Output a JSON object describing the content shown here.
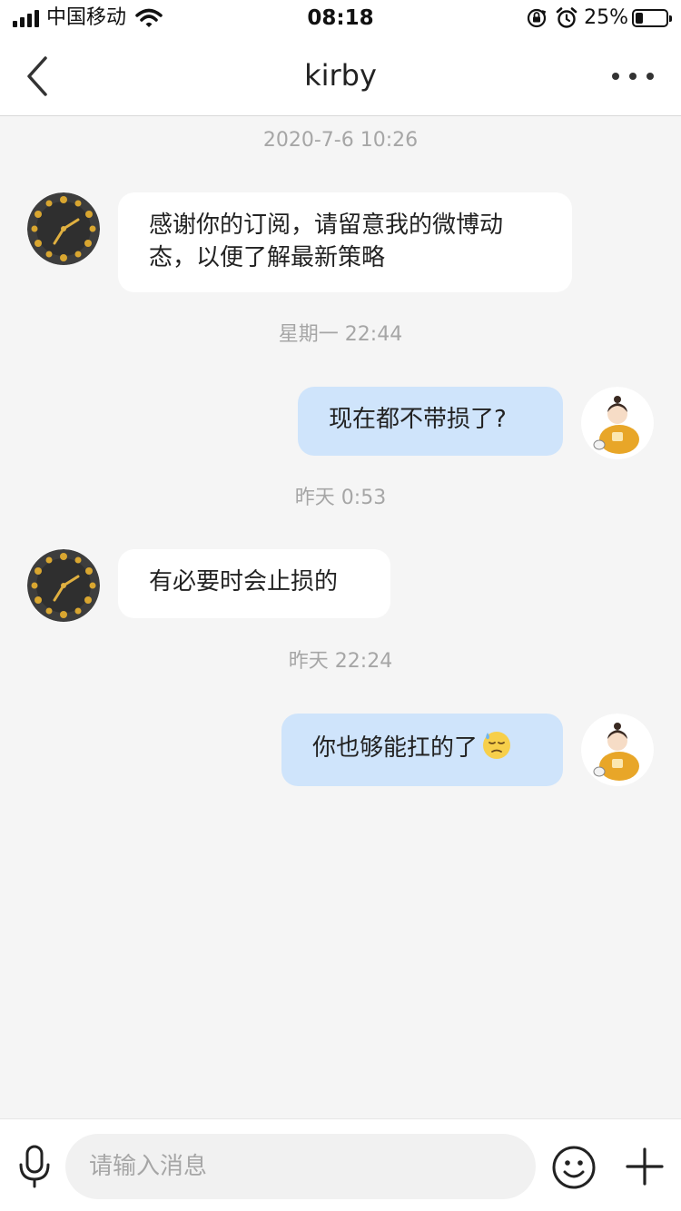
{
  "status_bar": {
    "carrier": "中国移动",
    "time": "08:18",
    "battery_percent": "25%",
    "battery_level": 0.25,
    "icons": [
      "signal-icon",
      "wifi-icon",
      "orientation-lock-icon",
      "alarm-icon",
      "battery-icon"
    ]
  },
  "nav": {
    "title": "kirby",
    "icons": [
      "back-chevron-icon",
      "more-dots-icon"
    ]
  },
  "messages": [
    {
      "timestamp": "2020-7-6 10:26",
      "direction": "incoming",
      "text": "感谢你的订阅，请留意我的微博动态，以便了解最新策略"
    },
    {
      "timestamp": "星期一 22:44",
      "direction": "outgoing",
      "text": "现在都不带损了?"
    },
    {
      "timestamp": "昨天 0:53",
      "direction": "incoming",
      "text": "有必要时会止损的"
    },
    {
      "timestamp": "昨天 22:24",
      "direction": "outgoing",
      "text": "你也够能扛的了",
      "emoji": "sweat-emoji-icon"
    }
  ],
  "input": {
    "placeholder": "请输入消息",
    "value": "",
    "icons": [
      "microphone-icon",
      "smiley-icon",
      "plus-icon"
    ]
  },
  "colors": {
    "background": "#f5f5f5",
    "bubble_incoming": "#ffffff",
    "bubble_outgoing": "#cfe4fb",
    "timestamp_text": "#a6a6a6"
  }
}
